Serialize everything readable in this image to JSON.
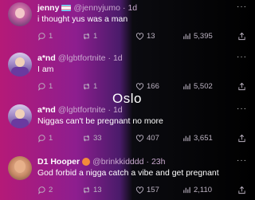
{
  "overlay_text": "Oslo",
  "tweets": [
    {
      "name": "jenny",
      "flag": "trans-flag",
      "handle": "@jennyjumo",
      "dot": "·",
      "time": "1d",
      "text": "i thought yus was a man",
      "more": "···",
      "replies": "1",
      "retweets": "1",
      "likes": "13",
      "views": "5,395",
      "icons": {
        "reply": "reply-icon",
        "retweet": "retweet-icon",
        "like": "heart-icon",
        "views": "views-icon",
        "share": "share-icon"
      }
    },
    {
      "name": "a*nd",
      "handle": "@lgbtfortnite",
      "dot": "·",
      "time": "1d",
      "text": "I am",
      "more": "···",
      "replies": "1",
      "retweets": "1",
      "likes": "166",
      "views": "5,502",
      "icons": {
        "reply": "reply-icon",
        "retweet": "retweet-icon",
        "like": "heart-icon",
        "views": "views-icon",
        "share": "share-icon"
      }
    },
    {
      "name": "a*nd",
      "handle": "@lgbtfortnite",
      "dot": "·",
      "time": "1d",
      "text": "Niggas can't be pregnant no more",
      "more": "···",
      "replies": "1",
      "retweets": "33",
      "likes": "407",
      "views": "3,651",
      "icons": {
        "reply": "reply-icon",
        "retweet": "retweet-icon",
        "like": "heart-icon",
        "views": "views-icon",
        "share": "share-icon"
      }
    },
    {
      "name": "D1 Hooper",
      "badge": "orange-badge",
      "handle": "@brinkkidddd",
      "dot": "·",
      "time": "23h",
      "text": "God forbid a nigga catch a vibe and get pregnant",
      "more": "···",
      "replies": "2",
      "retweets": "13",
      "likes": "157",
      "views": "2,110",
      "icons": {
        "reply": "reply-icon",
        "retweet": "retweet-icon",
        "like": "heart-icon",
        "views": "views-icon",
        "share": "share-icon"
      }
    }
  ]
}
